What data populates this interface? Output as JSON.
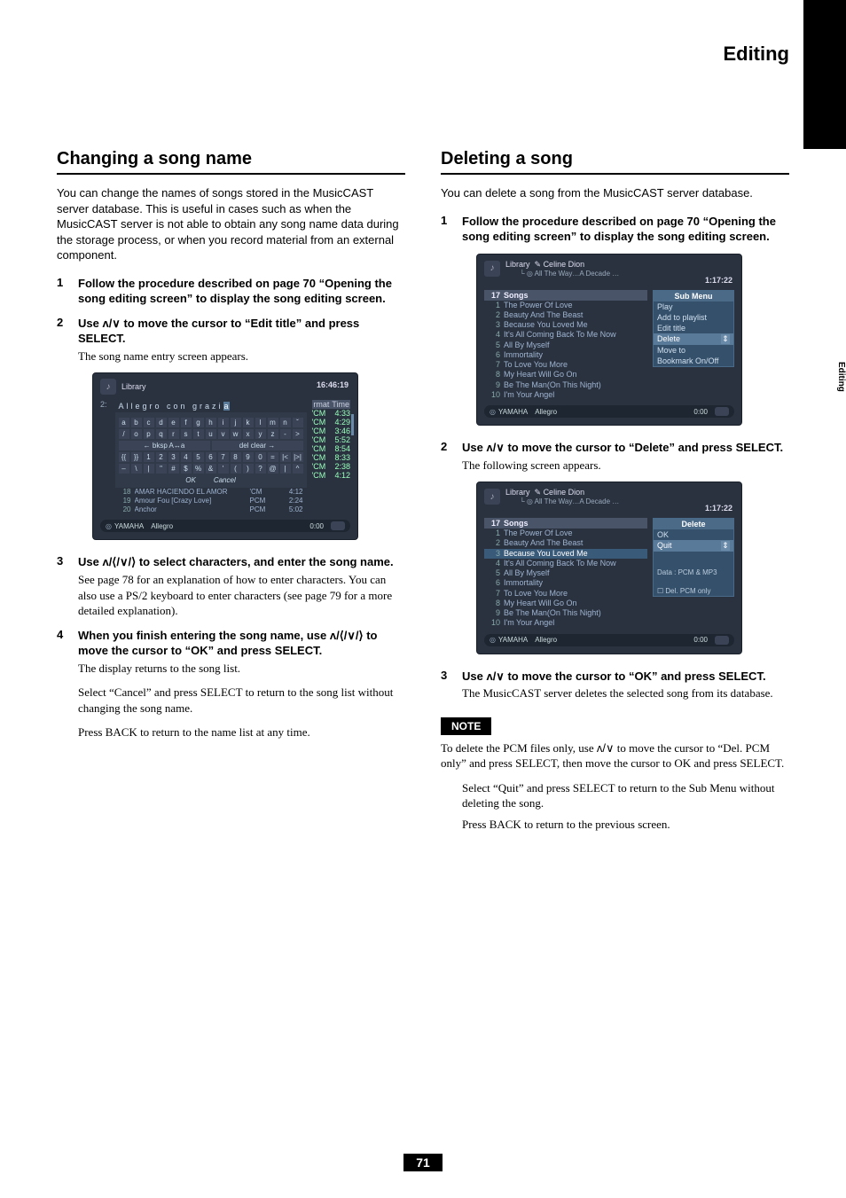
{
  "header": {
    "title": "Editing",
    "side_tab": "Editing"
  },
  "page_number": "71",
  "left": {
    "heading": "Changing a song name",
    "intro": "You can change the names of songs stored in the MusicCAST server database. This is useful in cases such as when the MusicCAST server is not able to obtain any song name data during the storage process, or when you record material from an external component.",
    "steps": {
      "s1": {
        "num": "1",
        "bold": "Follow the procedure described on page 70 “Opening the song editing screen” to display the song editing screen."
      },
      "s2": {
        "num": "2",
        "bold_a": "Use ",
        "bold_b": " to move the cursor to “Edit title” and press SELECT.",
        "plain": "The song name entry screen appears."
      },
      "s3": {
        "num": "3",
        "bold_a": "Use ",
        "bold_b": " to select characters, and enter the song name.",
        "plain": "See page 78 for an explanation of how to enter characters. You can also use a PS/2 keyboard to enter characters (see page 79 for a more detailed explanation)."
      },
      "s4": {
        "num": "4",
        "bold_a": "When you finish entering the song name, use ",
        "bold_b": " to move the cursor to “OK” and press SELECT.",
        "plain1": "The display returns to the song list.",
        "plain2": "Select “Cancel” and press SELECT to return to the song list without changing the song name.",
        "plain3": "Press BACK to return to the name list at any time."
      }
    },
    "shot": {
      "library": "Library",
      "time": "16:46:19",
      "col_num": "2:",
      "entry_pre": "Allegro con grazi",
      "entry_cur": "a",
      "fmt_h": "rmat",
      "time_h": "Time",
      "kb": {
        "r1": [
          "a",
          "b",
          "c",
          "d",
          "e",
          "f",
          "g",
          "h",
          "i",
          "j",
          "k",
          "l",
          "m",
          "n",
          "ˇ"
        ],
        "r2": [
          "/",
          "o",
          "p",
          "q",
          "r",
          "s",
          "t",
          "u",
          "v",
          "w",
          "x",
          "y",
          "z",
          "-",
          ">"
        ],
        "r3a": "← bksp A↔a",
        "r3b": "del  clear →",
        "r4": [
          "{{",
          "}}",
          "1",
          "2",
          "3",
          "4",
          "5",
          "6",
          "7",
          "8",
          "9",
          "0",
          "=",
          "|<",
          "|>|"
        ],
        "r5": [
          "–",
          "\\",
          "|",
          "\"",
          "#",
          "$",
          "%",
          "&",
          "'",
          "(",
          ")",
          "?",
          "@",
          "|",
          "^"
        ],
        "ok": "OK",
        "cancel": "Cancel"
      },
      "right_rows": [
        [
          "'CM",
          "4:33"
        ],
        [
          "'CM",
          "4:29"
        ],
        [
          "'CM",
          "3:46"
        ],
        [
          "'CM",
          "5:52"
        ],
        [
          "'CM",
          "8:54"
        ],
        [
          "'CM",
          "8:33"
        ],
        [
          "'CM",
          "2:38"
        ],
        [
          "'CM",
          "4:12"
        ]
      ],
      "below": [
        {
          "n": "18",
          "t": "AMAR HACIENDO EL AMOR",
          "f": "'CM",
          "d": "4:12"
        },
        {
          "n": "19",
          "t": "Amour Fou [Crazy Love]",
          "f": "PCM",
          "d": "2:24"
        },
        {
          "n": "20",
          "t": "Anchor",
          "f": "PCM",
          "d": "5:02"
        }
      ],
      "brand": "YAMAHA",
      "track": "Allegro",
      "ptime": "0:00"
    }
  },
  "right": {
    "heading": "Deleting a song",
    "intro": "You can delete a song from the MusicCAST server database.",
    "steps": {
      "s1": {
        "num": "1",
        "bold": "Follow the procedure described on page 70 “Opening the song editing screen” to display the song editing screen."
      },
      "s2": {
        "num": "2",
        "bold_a": "Use ",
        "bold_b": " to move the cursor to “Delete” and press SELECT.",
        "plain": "The following screen appears."
      },
      "s3": {
        "num": "3",
        "bold_a": "Use ",
        "bold_b": " to move the cursor to “OK” and press SELECT.",
        "plain": "The MusicCAST server deletes the selected song from its database."
      }
    },
    "note_label": "NOTE",
    "note_text_a": "To delete the PCM files only, use ",
    "note_text_b": " to move the cursor to “Del. PCM only” and press SELECT, then move the cursor to OK and press SELECT.",
    "tail1": "Select “Quit” and press SELECT to return to the Sub Menu without deleting the song.",
    "tail2": "Press BACK to return to the previous screen.",
    "shot_common": {
      "library": "Library",
      "artist": "Celine Dion",
      "album": "All The Way…A Decade …",
      "time": "1:17:22",
      "count": "17",
      "songs_h": "Songs",
      "brand": "YAMAHA",
      "track": "Allegro",
      "ptime": "0:00",
      "songs": [
        {
          "n": "1",
          "t": "The Power Of Love"
        },
        {
          "n": "2",
          "t": "Beauty And The Beast"
        },
        {
          "n": "3",
          "t": "Because You Loved Me"
        },
        {
          "n": "4",
          "t": "It's All Coming Back To Me Now"
        },
        {
          "n": "5",
          "t": "All By Myself"
        },
        {
          "n": "6",
          "t": "Immortality"
        },
        {
          "n": "7",
          "t": "To Love You More"
        },
        {
          "n": "8",
          "t": "My Heart Will Go On"
        },
        {
          "n": "9",
          "t": "Be The Man(On This Night)"
        },
        {
          "n": "10",
          "t": "I'm Your Angel"
        }
      ]
    },
    "shot1_menu": {
      "title": "Sub Menu",
      "items": [
        "Play",
        "Add to playlist",
        "Edit title"
      ],
      "hl": "Delete",
      "items2": [
        "Move to",
        "Bookmark On/Off"
      ]
    },
    "shot2_menu": {
      "title": "Delete",
      "ok": "OK",
      "quit": "Quit",
      "data": "Data : PCM & MP3",
      "del_pcm": "Del. PCM only"
    }
  },
  "icons": {
    "updown": "ʌ/∨",
    "dirs": "ʌ/⟨/∨/⟩"
  }
}
